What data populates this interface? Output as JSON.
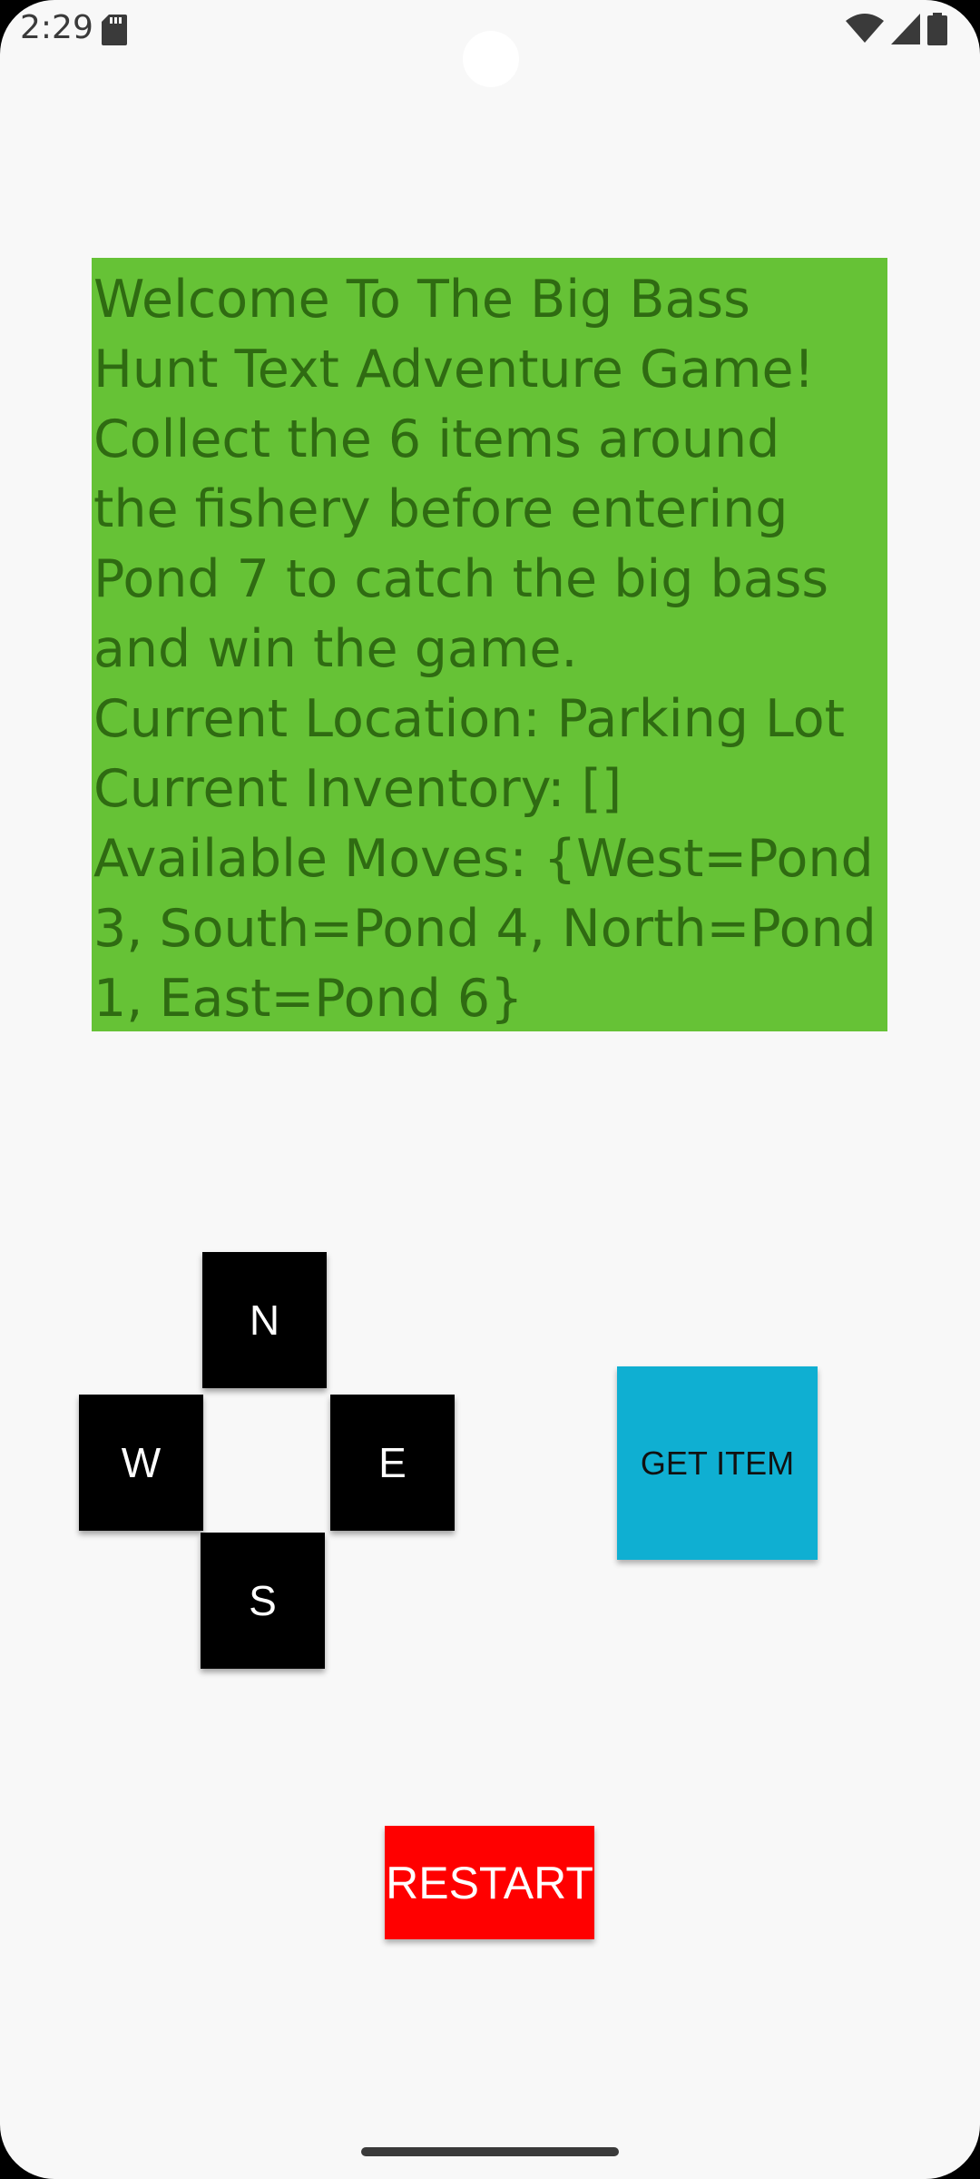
{
  "status_bar": {
    "time": "2:29",
    "icons": [
      "sd-card-icon",
      "wifi-icon",
      "signal-icon",
      "battery-icon"
    ]
  },
  "message": {
    "lines": [
      "Welcome To The Big Bass",
      "Hunt Text Adventure Game!",
      "Collect the 6 items around",
      "the fishery before entering",
      "Pond 7 to catch the big bass",
      "and win the game.",
      "Current Location: Parking Lot",
      "Current Inventory: []",
      "Available Moves: {West=Pond",
      "3, South=Pond 4, North=Pond",
      "1, East=Pond 6}"
    ]
  },
  "controls": {
    "north_label": "N",
    "west_label": "W",
    "east_label": "E",
    "south_label": "S",
    "get_item_label": "GET ITEM",
    "restart_label": "RESTART"
  },
  "colors": {
    "message_bg": "#66c236",
    "message_text": "#2f6b12",
    "direction_bg": "#000000",
    "get_item_bg": "#0fafd2",
    "restart_bg": "#ff0000"
  }
}
